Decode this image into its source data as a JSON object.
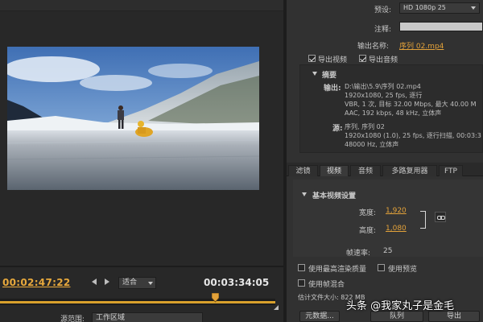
{
  "export": {
    "preset_label": "预设:",
    "preset_value": "HD 1080p 25",
    "comment_label": "注释:",
    "output_name_label": "输出名称:",
    "output_name_value": "序列 02.mp4",
    "export_video_label": "导出视频",
    "export_video_checked": true,
    "export_audio_label": "导出音频",
    "export_audio_checked": true
  },
  "summary": {
    "title": "摘要",
    "output_label": "输出:",
    "output_lines": [
      "D:\\输出\\5.9\\序列 02.mp4",
      "1920x1080, 25 fps, 逐行",
      "VBR, 1 次, 目标 32.00 Mbps, 最大 40.00 M",
      "AAC, 192 kbps, 48 kHz, 立体声"
    ],
    "source_label": "源:",
    "source_lines": [
      "序列, 序列 02",
      "1920x1080 (1.0), 25 fps, 逐行扫描, 00:03:3",
      "48000 Hz, 立体声"
    ]
  },
  "tabs": [
    "滤镜",
    "视频",
    "音频",
    "多路复用器",
    "FTP"
  ],
  "active_tab": "视频",
  "video": {
    "section_title": "基本视频设置",
    "width_label": "宽度:",
    "width_value": "1,920",
    "height_label": "高度:",
    "height_value": "1,080",
    "framerate_label": "帧速率:",
    "framerate_value": "25"
  },
  "options": {
    "max_render_quality_label": "使用最高渲染质量",
    "use_previews_label": "使用预览",
    "frame_blending_label": "使用帧混合",
    "estimated_size": "估计文件大小: 822 MB"
  },
  "buttons": {
    "metadata": "元数据...",
    "queue": "队列",
    "export": "导出"
  },
  "playback": {
    "current_timecode": "00:02:47:22",
    "duration_timecode": "00:03:34:05",
    "fit_label": "适合",
    "progress_fraction": 0.78,
    "source_range_label": "源范围:",
    "source_range_value": "工作区域"
  },
  "watermark": "头条 @我家丸子是金毛",
  "colors": {
    "accent_orange": "#e3a23a",
    "panel_bg": "#313131",
    "preview_bg": "#282828"
  }
}
